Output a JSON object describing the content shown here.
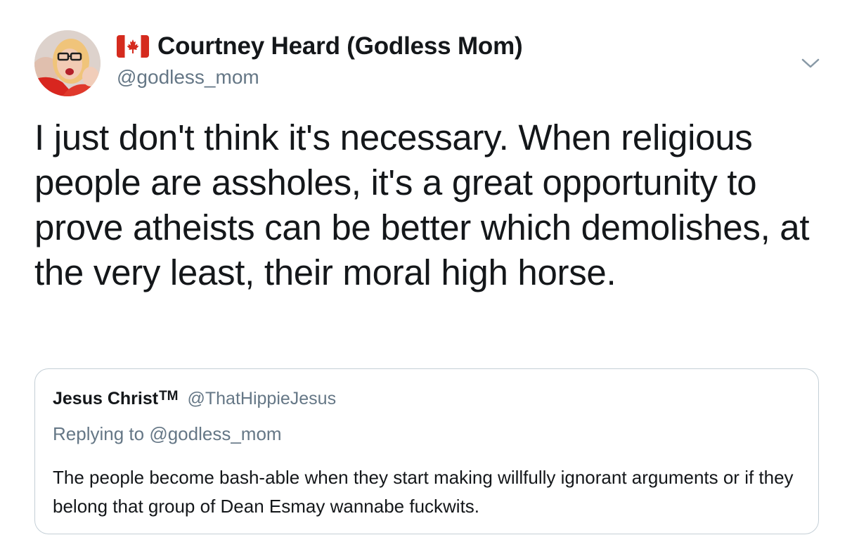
{
  "tweet": {
    "author": {
      "flag_icon": "canada-flag-icon",
      "display_name": "Courtney Heard (Godless Mom)",
      "handle": "@godless_mom",
      "avatar_icon": "profile-photo-avatar"
    },
    "menu_icon": "chevron-down-icon",
    "text": "I just don't think it's necessary. When religious people are assholes, it's a great opportunity to prove atheists can be better which demolishes, at the very least, their moral high horse.",
    "quoted_tweet": {
      "display_name": "Jesus Christ",
      "trademark": "TM",
      "handle": "@ThatHippieJesus",
      "reply_prefix": "Replying to",
      "reply_handle": "@godless_mom",
      "text": "The people become bash-able when they start making willfully ignorant arguments or if they belong that group of Dean Esmay wannabe fuckwits."
    }
  },
  "colors": {
    "text_primary": "#14171a",
    "text_secondary": "#657786",
    "border": "#c4cfd6",
    "flag_red": "#d52b1e"
  }
}
